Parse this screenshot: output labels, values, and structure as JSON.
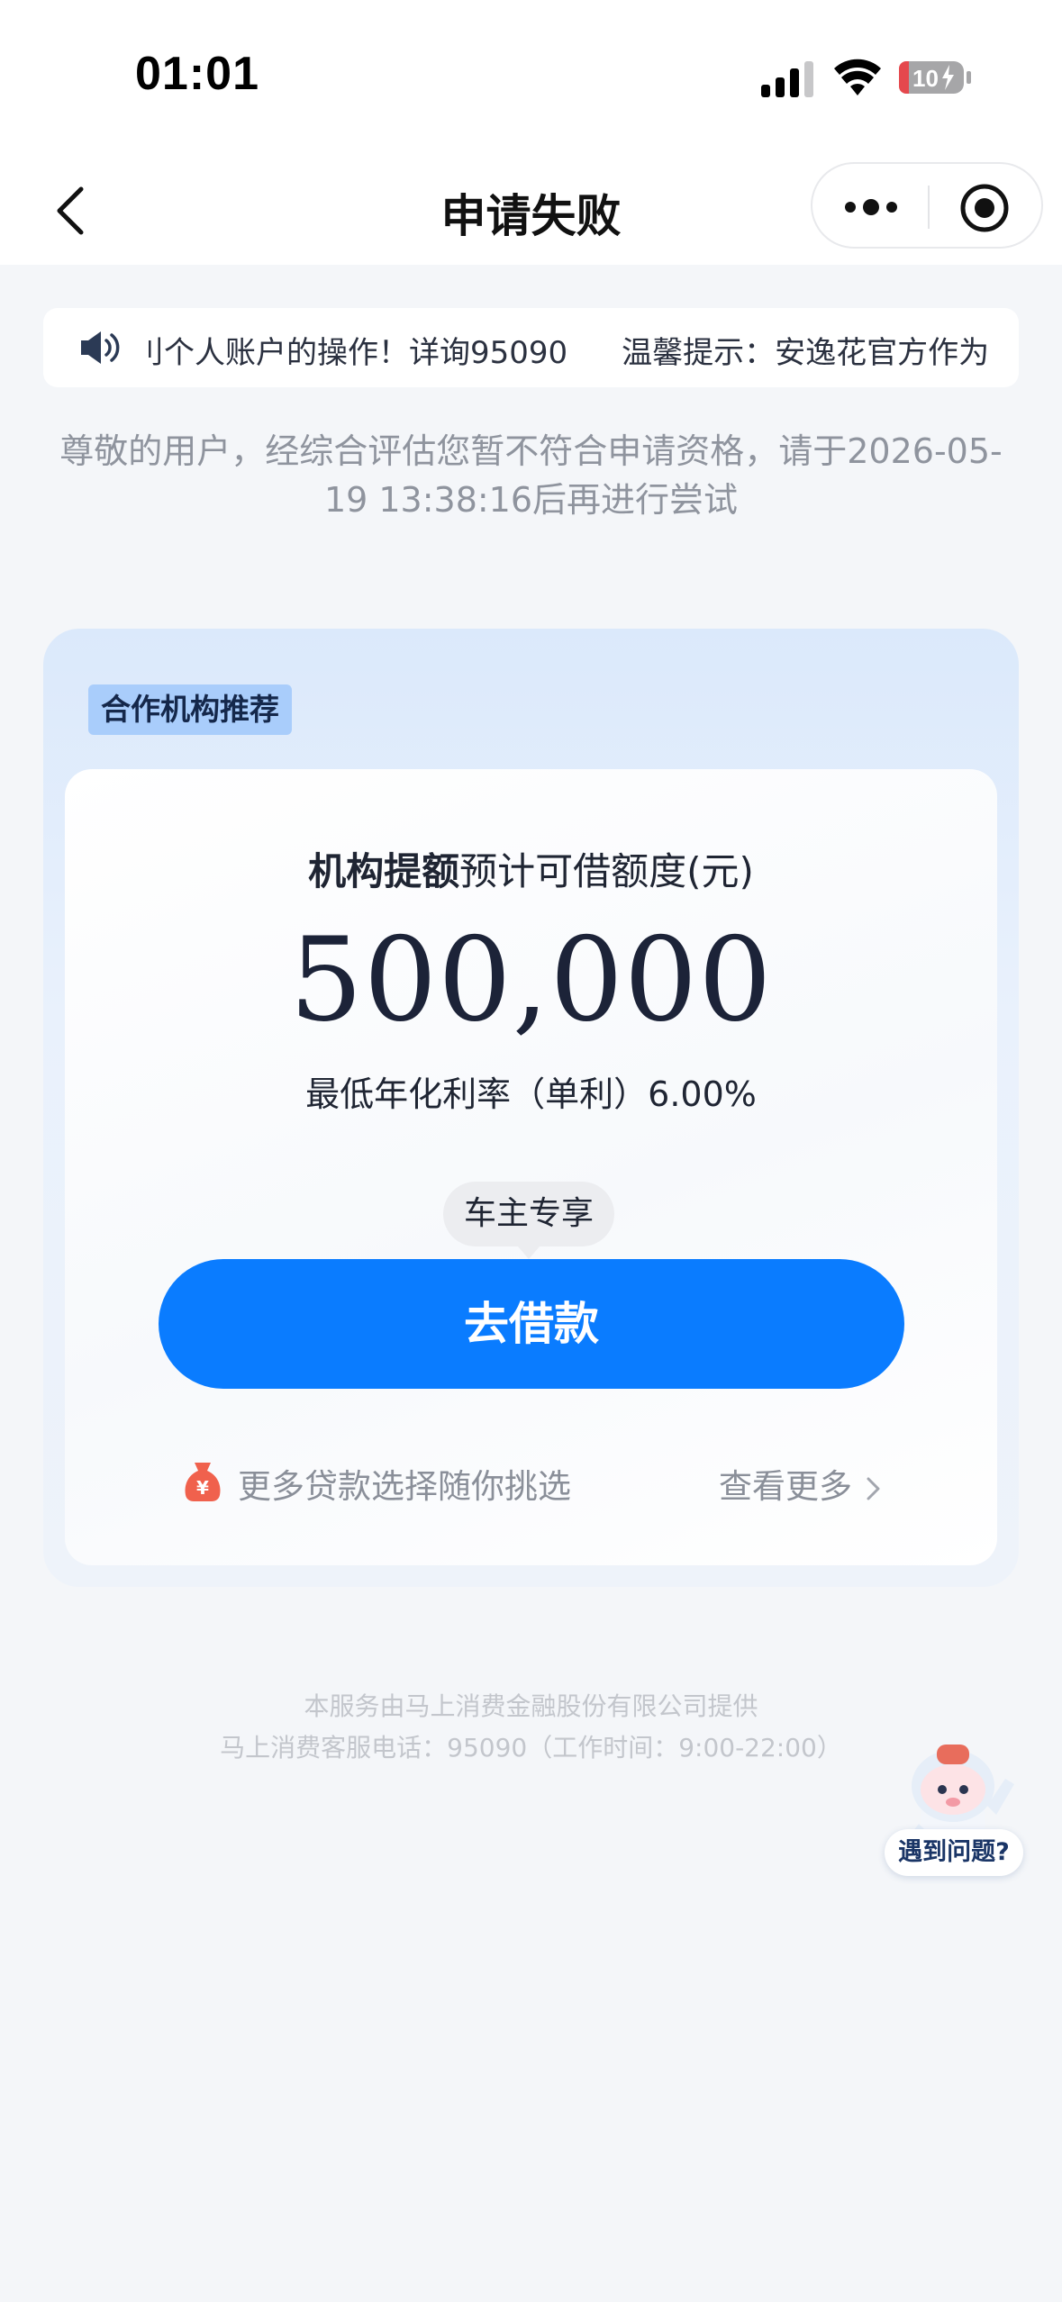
{
  "status_bar": {
    "time": "01:01",
    "battery_level": "10"
  },
  "nav": {
    "title": "申请失败"
  },
  "notice": {
    "text_part1": "刂个人账户的操作！详询95090",
    "text_part2": "温馨提示：安逸花官方作为"
  },
  "result": {
    "message": "尊敬的用户，经综合评估您暂不符合申请资格，请于2026-05-19 13:38:16后再进行尝试"
  },
  "recommend": {
    "tag": "合作机构推荐",
    "label_bold": "机构提额",
    "label_rest": "预计可借额度(元)",
    "amount": "500,000",
    "rate": "最低年化利率（单利）6.00%",
    "badge": "车主专享",
    "button": "去借款",
    "more_text": "更多贷款选择随你挑选",
    "see_more": "查看更多"
  },
  "footer": {
    "line1": "本服务由马上消费金融股份有限公司提供",
    "line2": "马上消费客服电话：95090（工作时间：9:00-22:00）"
  },
  "helper": {
    "label": "遇到问题?"
  },
  "colors": {
    "primary": "#0a7cff",
    "tag_bg": "#a9cdfb",
    "battery_low": "#e5484d"
  }
}
